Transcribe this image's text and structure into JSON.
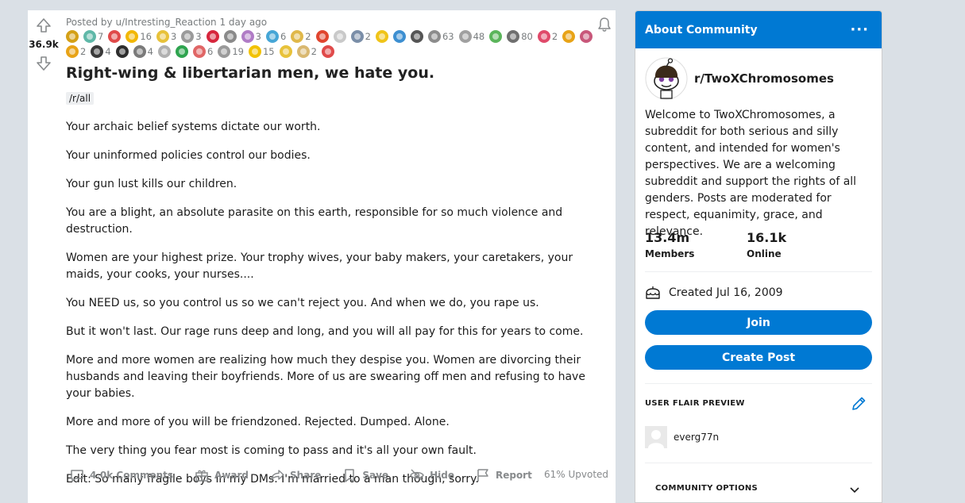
{
  "post": {
    "score": "36.9k",
    "meta_prefix": "Posted by",
    "author": "u/Intresting_Reaction",
    "time": "1 day ago",
    "awards_row1": [
      {
        "color": "#d4a017",
        "count": ""
      },
      {
        "color": "#5fb8a8",
        "count": "7"
      },
      {
        "color": "#e04a4a",
        "count": ""
      },
      {
        "color": "#f2b705",
        "count": "16"
      },
      {
        "color": "#e8c23a",
        "count": "3"
      },
      {
        "color": "#9a9a9a",
        "count": "3"
      },
      {
        "color": "#d7263d",
        "count": ""
      },
      {
        "color": "#8a8a8a",
        "count": ""
      },
      {
        "color": "#b07cc6",
        "count": "3"
      },
      {
        "color": "#46a6d6",
        "count": "6"
      },
      {
        "color": "#e0b84a",
        "count": "2"
      },
      {
        "color": "#e0452f",
        "count": ""
      },
      {
        "color": "#c9c9c9",
        "count": ""
      },
      {
        "color": "#7a8ea8",
        "count": "2"
      },
      {
        "color": "#f0c419",
        "count": ""
      },
      {
        "color": "#3d8fd1",
        "count": ""
      },
      {
        "color": "#555555",
        "count": ""
      },
      {
        "color": "#8c8c8c",
        "count": "63"
      },
      {
        "color": "#a0a0a0",
        "count": "48"
      },
      {
        "color": "#5bb55b",
        "count": ""
      },
      {
        "color": "#6f6f6f",
        "count": "80"
      },
      {
        "color": "#e04a6a",
        "count": "2"
      },
      {
        "color": "#e8a317",
        "count": ""
      },
      {
        "color": "#c8577a",
        "count": ""
      }
    ],
    "awards_row2": [
      {
        "color": "#e8a317",
        "count": "2"
      },
      {
        "color": "#3a3a3a",
        "count": "4"
      },
      {
        "color": "#2d2d2d",
        "count": ""
      },
      {
        "color": "#7a7a7a",
        "count": "4"
      },
      {
        "color": "#b0b0b0",
        "count": ""
      },
      {
        "color": "#2ea44f",
        "count": ""
      },
      {
        "color": "#e06666",
        "count": "6"
      },
      {
        "color": "#9a9a9a",
        "count": "19"
      },
      {
        "color": "#f2c200",
        "count": "15"
      },
      {
        "color": "#e8c23a",
        "count": ""
      },
      {
        "color": "#d9b870",
        "count": "2"
      },
      {
        "color": "#e04a4a",
        "count": ""
      }
    ],
    "title": "Right-wing & libertarian men, we hate you.",
    "flair": "/r/all",
    "paragraphs": [
      "Your archaic belief systems dictate our worth.",
      "Your uninformed policies control our bodies.",
      "Your gun lust kills our children.",
      "You are a blight, an absolute parasite on this earth, responsible for so much violence and destruction.",
      "Women are your highest prize. Your trophy wives, your baby makers, your caretakers, your maids, your cooks, your nurses....",
      "You NEED us, so you control us so we can't reject you. And when we do, you rape us.",
      "But it won't last. Our rage runs deep and long, and you will all pay for this for years to come.",
      "More and more women are realizing how much they despise you. Women are divorcing their husbands and leaving their boyfriends. More of us are swearing off men and refusing to have your babies.",
      "More and more of you will be friendzoned. Rejected. Dumped. Alone.",
      "The very thing you fear most is coming to pass and it's all your own fault.",
      "Edit: So many fragile boys in my DMs. I'm married to a man though, sorry."
    ],
    "actions": {
      "comments": "4.0k Comments",
      "award": "Award",
      "share": "Share",
      "save": "Save",
      "hide": "Hide",
      "report": "Report"
    },
    "upvoted": "61% Upvoted"
  },
  "sidebar": {
    "header": "About Community",
    "community_name": "r/TwoXChromosomes",
    "description": "Welcome to TwoXChromosomes, a subreddit for both serious and silly content, and intended for women's perspectives. We are a welcoming subreddit and support the rights of all genders. Posts are moderated for respect, equanimity, grace, and relevance.",
    "members_value": "13.4m",
    "members_label": "Members",
    "online_value": "16.1k",
    "online_label": "Online",
    "created": "Created Jul 16, 2009",
    "join": "Join",
    "create_post": "Create Post",
    "flair_preview_label": "USER FLAIR PREVIEW",
    "flair_username": "everg77n",
    "community_options": "COMMUNITY OPTIONS"
  },
  "colors": {
    "accent": "#0079d3",
    "background": "#dae0e6",
    "muted": "#878a8c"
  }
}
